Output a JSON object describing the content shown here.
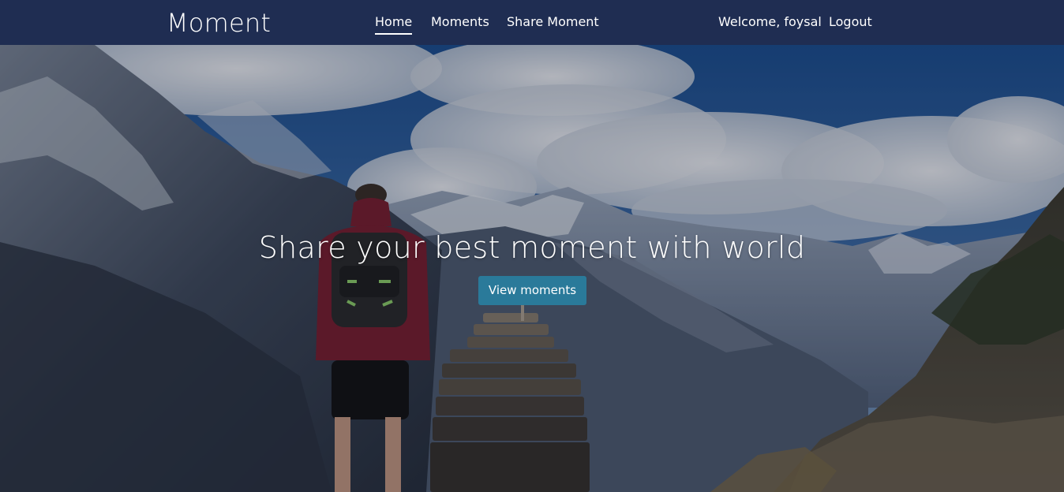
{
  "navbar": {
    "brand": "Moment",
    "links": [
      {
        "label": "Home",
        "active": true
      },
      {
        "label": "Moments",
        "active": false
      },
      {
        "label": "Share Moment",
        "active": false
      }
    ],
    "welcome": "Welcome, foysal",
    "logout": "Logout"
  },
  "hero": {
    "title": "Share your best moment with world",
    "button_label": "View moments",
    "image_subject": "hiker with backpack looking at snowy mountain range beside stone cairn"
  },
  "colors": {
    "navbar_bg": "#1f2d52",
    "button_bg": "#2a7a9a",
    "text": "#ffffff"
  }
}
